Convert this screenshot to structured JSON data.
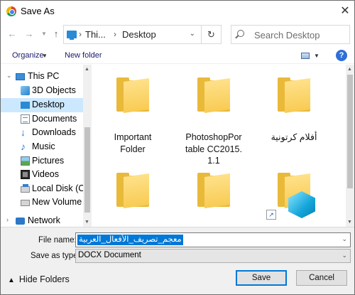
{
  "window": {
    "title": "Save As",
    "close_glyph": "✕"
  },
  "address_bar": {
    "crumbs": [
      "Thi...",
      "Desktop"
    ],
    "search_placeholder": "Search Desktop"
  },
  "toolbar": {
    "organize_label": "Organize",
    "new_folder_label": "New folder",
    "help_glyph": "?"
  },
  "nav_pane": {
    "items": [
      {
        "label": "This PC",
        "icon": "this-pc-icon"
      },
      {
        "label": "3D Objects",
        "icon": "3d-objects-icon"
      },
      {
        "label": "Desktop",
        "icon": "desktop-icon",
        "selected": true
      },
      {
        "label": "Documents",
        "icon": "documents-icon"
      },
      {
        "label": "Downloads",
        "icon": "downloads-icon"
      },
      {
        "label": "Music",
        "icon": "music-icon"
      },
      {
        "label": "Pictures",
        "icon": "pictures-icon"
      },
      {
        "label": "Videos",
        "icon": "videos-icon"
      },
      {
        "label": "Local Disk (C",
        "icon": "local-disk-icon"
      },
      {
        "label": "New Volume",
        "icon": "new-volume-icon"
      },
      {
        "label": "Network",
        "icon": "network-icon"
      }
    ]
  },
  "files": {
    "items": [
      {
        "label": "Important Folder",
        "type": "folder"
      },
      {
        "label": "PhotoshopPortable CC2015.1.1",
        "type": "folder"
      },
      {
        "label": "أفلام كرتونية",
        "type": "folder"
      },
      {
        "label": "",
        "type": "folder"
      },
      {
        "label": "",
        "type": "folder"
      },
      {
        "label": "",
        "type": "folder-shortcut"
      }
    ]
  },
  "save_fields": {
    "file_name_label": "File name:",
    "file_name_value": "معجم_تصريف_الأفعال_العربية",
    "save_type_label": "Save as type:",
    "save_type_value": "DOCX Document"
  },
  "footer": {
    "hide_folders_label": "Hide Folders",
    "save_label": "Save",
    "cancel_label": "Cancel"
  },
  "colors": {
    "selection": "#cce8ff",
    "accent": "#0078d7",
    "folder": "#f8cb53"
  }
}
